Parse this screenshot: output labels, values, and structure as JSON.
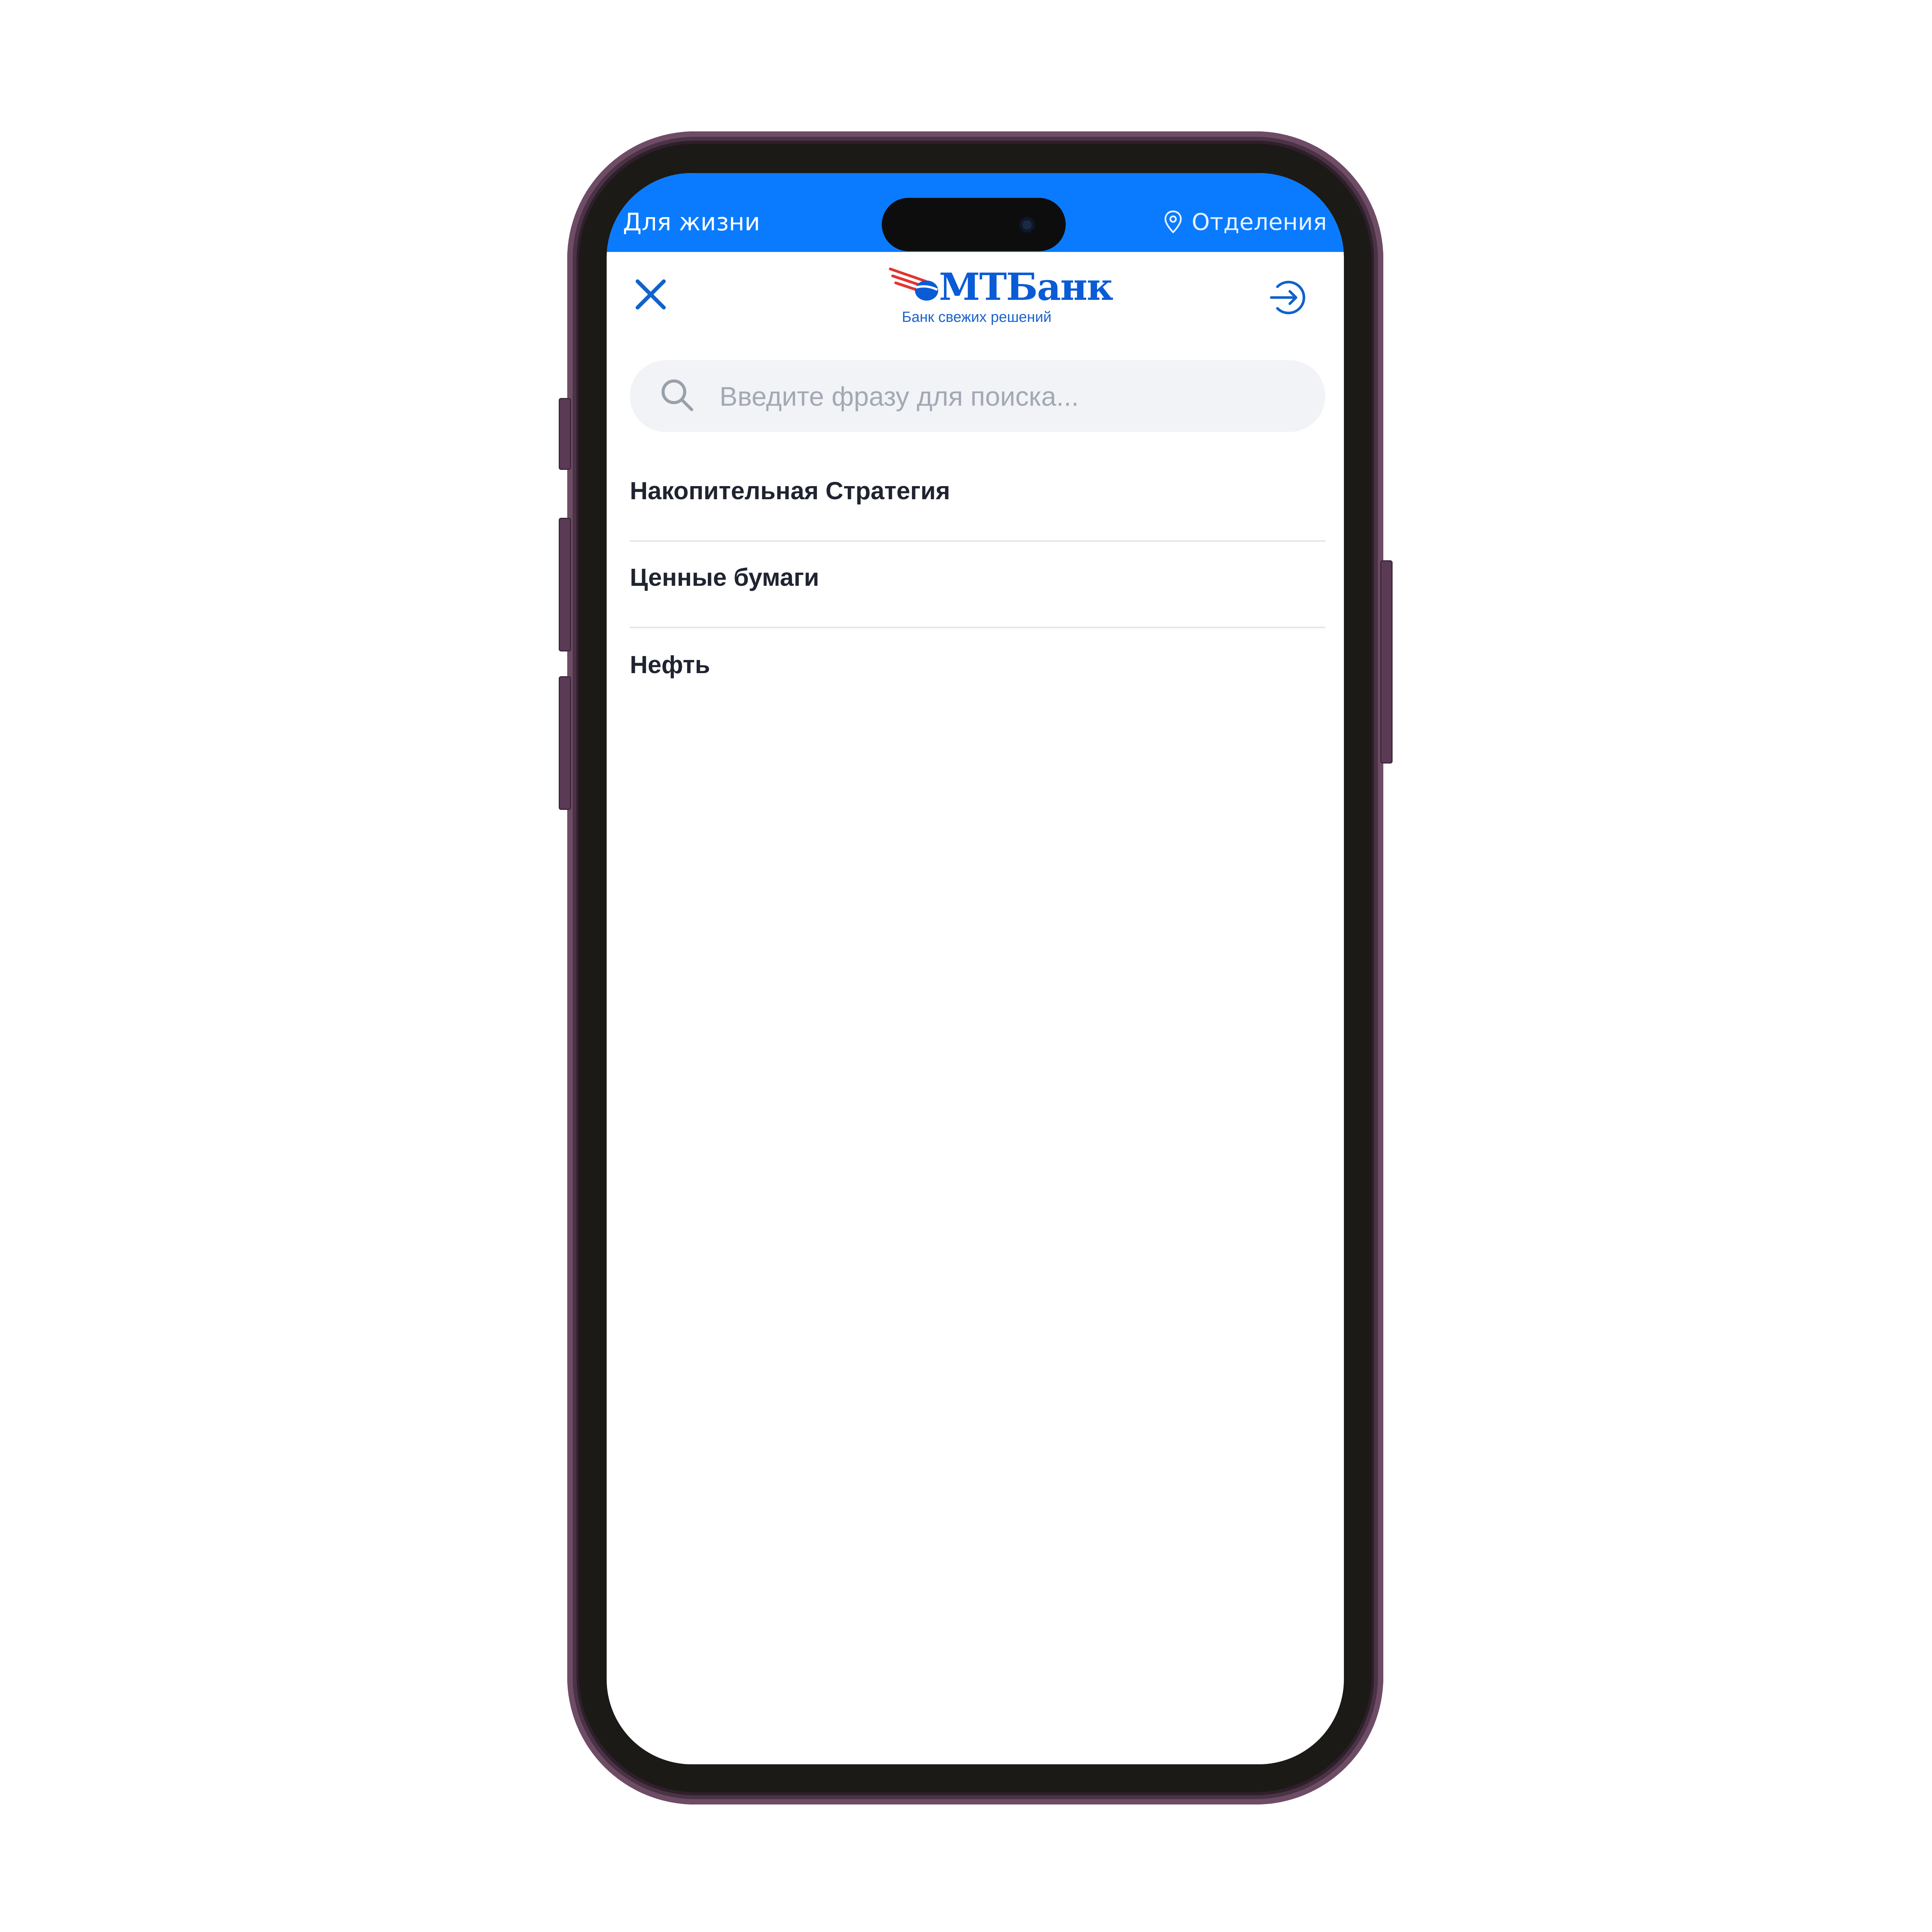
{
  "topbar": {
    "left_label": "Для жизни",
    "branches_label": "Отделения",
    "branches_icon": "location-pin-icon",
    "background": "#0a7bff"
  },
  "header": {
    "close_icon": "close-icon",
    "logo": {
      "name": "МТБанк",
      "tagline": "Банк свежих решений"
    },
    "login_icon": "login-arrow-icon",
    "accent": "#0a5bd6"
  },
  "search": {
    "placeholder": "Введите фразу для поиска...",
    "value": "",
    "icon": "search-icon"
  },
  "results": [
    {
      "label": "Накопительная Стратегия"
    },
    {
      "label": "Ценные бумаги"
    },
    {
      "label": "Нефть"
    }
  ]
}
